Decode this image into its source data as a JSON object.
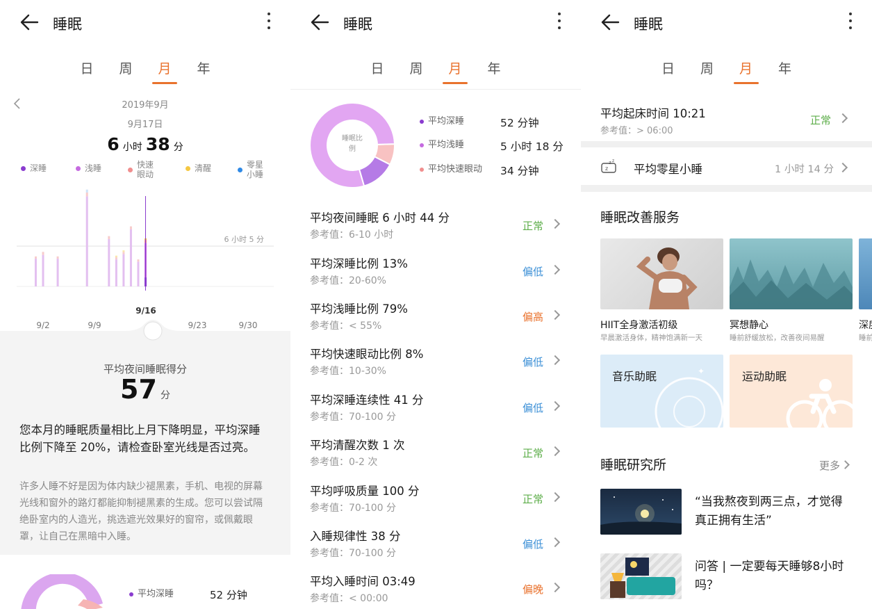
{
  "header": {
    "title": "睡眠"
  },
  "tabs": [
    "日",
    "周",
    "月",
    "年"
  ],
  "panel1": {
    "month": "2019年9月",
    "date": "9月17日",
    "duration": {
      "h": "6",
      "h_unit": "小时",
      "m": "38",
      "m_unit": "分"
    },
    "legend": [
      {
        "label": "深睡",
        "color": "#8a3ccf"
      },
      {
        "label": "浅睡",
        "color": "#c56be0"
      },
      {
        "label": "快速眼动",
        "color": "#f08e8e"
      },
      {
        "label": "清醒",
        "color": "#f5c842"
      },
      {
        "label": "零星小睡",
        "color": "#2f8ae6"
      }
    ],
    "ref_label": "6 小时 5 分",
    "selected_label": "9/16",
    "x_labels": [
      "9/2",
      "9/9",
      "9/23",
      "9/30"
    ],
    "score_title": "平均夜间睡眠得分",
    "score": "57",
    "score_unit": "分",
    "advice": "您本月的睡眠质量相比上月下降明显，平均深睡比例下降至 20%，请检查卧室光线是否过亮。",
    "tip": "许多人睡不好是因为体内缺少褪黑素，手机、电视的屏幕光线和窗外的路灯都能抑制褪黑素的生成。您可以尝试隔绝卧室内的人造光，挑选遮光效果好的窗帘，或佩戴眼罩，让自己在黑暗中入睡。",
    "bottom_legend_label": "平均深睡",
    "bottom_legend_value": "52 分钟"
  },
  "chart_data": {
    "type": "bar",
    "title": "",
    "xlabel": "",
    "ylabel": "",
    "reference_line": "6 小时 5 分",
    "selected": "9/16",
    "x_tick_labels": [
      "9/2",
      "9/9",
      "9/23",
      "9/30"
    ],
    "categories": [
      "9/1",
      "9/2",
      "9/4",
      "9/8",
      "9/11",
      "9/12",
      "9/13",
      "9/14",
      "9/15",
      "9/16"
    ],
    "series": [
      {
        "name": "深睡",
        "values": [
          0,
          0,
          0,
          0,
          0,
          0,
          0,
          0,
          0,
          1.2
        ]
      },
      {
        "name": "浅睡",
        "values": [
          3.7,
          4.2,
          3.7,
          12.0,
          6.3,
          3.6,
          4.3,
          7.6,
          3.3,
          4.6
        ]
      },
      {
        "name": "快速眼动",
        "values": [
          0.3,
          0.4,
          0.3,
          0.5,
          0.4,
          0.3,
          0.3,
          0.4,
          0.3,
          0.4
        ]
      },
      {
        "name": "清醒",
        "values": [
          0,
          0,
          0,
          0,
          0,
          0.2,
          0.2,
          0,
          0,
          0.2
        ]
      },
      {
        "name": "零星小睡",
        "values": [
          0,
          0,
          0,
          0.4,
          0,
          0,
          0,
          0,
          0,
          0
        ]
      }
    ]
  },
  "panel2": {
    "donut_center": "睡眠比例",
    "ratios": [
      {
        "label": "平均深睡",
        "value": "52 分钟",
        "color": "#8a3ccf",
        "share": 13
      },
      {
        "label": "平均浅睡",
        "value": "5 小时 18 分",
        "color": "#c56be0",
        "share": 79
      },
      {
        "label": "平均快速眼动",
        "value": "34 分钟",
        "color": "#f08e8e",
        "share": 8
      }
    ],
    "rows": [
      {
        "title": "平均夜间睡眠  6 小时 44 分",
        "ref": "参考值：6-10 小时",
        "status": "正常",
        "color": "#5dae4a"
      },
      {
        "title": "平均深睡比例  13%",
        "ref": "参考值：20-60%",
        "status": "偏低",
        "color": "#3b8fd6"
      },
      {
        "title": "平均浅睡比例  79%",
        "ref": "参考值：< 55%",
        "status": "偏高",
        "color": "#e9722d"
      },
      {
        "title": "平均快速眼动比例  8%",
        "ref": "参考值：10-30%",
        "status": "偏低",
        "color": "#3b8fd6"
      },
      {
        "title": "平均深睡连续性  41 分",
        "ref": "参考值：70-100 分",
        "status": "偏低",
        "color": "#3b8fd6"
      },
      {
        "title": "平均清醒次数  1 次",
        "ref": "参考值：0-2 次",
        "status": "正常",
        "color": "#5dae4a"
      },
      {
        "title": "平均呼吸质量  100 分",
        "ref": "参考值：70-100 分",
        "status": "正常",
        "color": "#5dae4a"
      },
      {
        "title": "入睡规律性  38 分",
        "ref": "参考值：70-100 分",
        "status": "偏低",
        "color": "#3b8fd6"
      },
      {
        "title": "平均入睡时间  03:49",
        "ref": "参考值：< 00:00",
        "status": "偏晚",
        "color": "#e9722d"
      }
    ]
  },
  "panel3": {
    "wake": {
      "title": "平均起床时间  10:21",
      "ref": "参考值：> 06:00",
      "status": "正常",
      "color": "#5dae4a"
    },
    "nap": {
      "title": "平均零星小睡",
      "value": "1 小时 14 分"
    },
    "service_title": "睡眠改善服务",
    "services": [
      {
        "title": "HIIT全身激活初级",
        "desc": "早晨激活身体，精神饱满新一天"
      },
      {
        "title": "冥想静心",
        "desc": "睡前舒缓放松，改善夜间易醒"
      },
      {
        "title": "深度",
        "desc": "睡前"
      }
    ],
    "aids": [
      {
        "title": "音乐助眠"
      },
      {
        "title": "运动助眠"
      }
    ],
    "research_title": "睡眠研究所",
    "research_more": "更多",
    "articles": [
      {
        "title": "“当我熬夜到两三点，才觉得真正拥有生活”"
      },
      {
        "title": "问答 | 一定要每天睡够8小时吗？"
      }
    ]
  }
}
